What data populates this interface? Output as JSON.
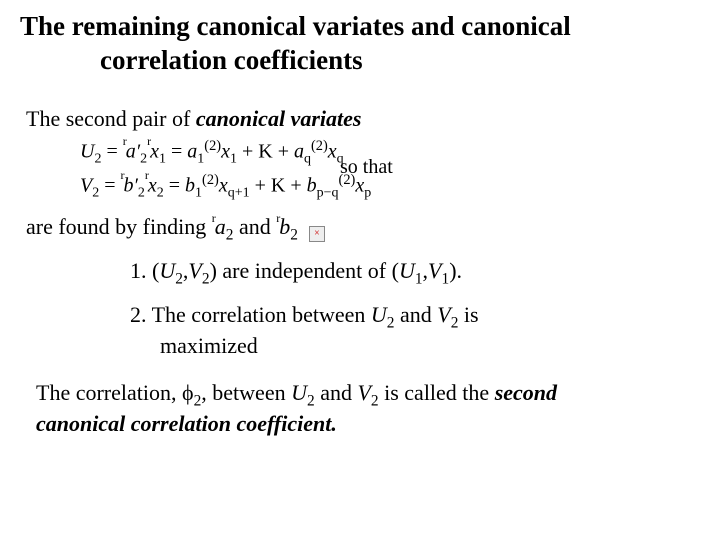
{
  "title": {
    "line1": "The remaining canonical variates and canonical",
    "line2": "correlation coefficients"
  },
  "intro": {
    "prefix": "The second pair of ",
    "emph": "canonical variates"
  },
  "equations": {
    "u": {
      "lhs_var": "U",
      "lhs_sub": "2",
      "a_prime": "a′",
      "a_sub": "2",
      "x_var": "x",
      "x_sub1": "1",
      "eq_a1": "a",
      "sub_a1": "1",
      "sup_a1": "(2)",
      "var_x1": "x",
      "subx1": "1",
      "dots": "K",
      "eq_aq": "a",
      "sub_aq": "q",
      "sup_aq": "(2)",
      "var_xq": "x",
      "subxq": "q"
    },
    "v": {
      "lhs_var": "V",
      "lhs_sub": "2",
      "b_prime": "b′",
      "b_sub": "2",
      "x_var": "x",
      "x_sub2": "2",
      "eq_b1": "b",
      "sub_b1": "1",
      "sup_b1": "(2)",
      "var_xq1": "x",
      "subxq1": "q+1",
      "dots": "K",
      "eq_bp": "b",
      "sub_bp": "p−q",
      "sup_bp": "(2)",
      "var_xp": "x",
      "subxp": "p"
    },
    "so_that": "so that"
  },
  "found": {
    "prefix": "are found by finding  ",
    "a_var": "a",
    "a_sub": "2",
    "and": "  and  ",
    "b_var": "b",
    "b_sub": "2"
  },
  "list": {
    "item1": {
      "num": "1.  (",
      "u": "U",
      "usub": "2",
      "comma": ",",
      "v": "V",
      "vsub": "2",
      "mid": ") are independent of (",
      "u1": "U",
      "u1sub": "1",
      "comma2": ",",
      "v1": "V",
      "v1sub": "1",
      "end": ")."
    },
    "item2": {
      "num": "2.  The correlation between ",
      "u": "U",
      "usub": "2",
      "and": " and ",
      "v": "V",
      "vsub": "2",
      "is": " is",
      "cont": "maximized"
    }
  },
  "conclusion": {
    "p1": "The correlation, ",
    "phi": "ϕ",
    "phisub": "2",
    "p2": ", between ",
    "u": "U",
    "usub": "2",
    "and": " and ",
    "v": "V",
    "vsub": "2",
    "p3": " is called the ",
    "emph1": "second",
    "emph2": "canonical correlation coefficient."
  }
}
